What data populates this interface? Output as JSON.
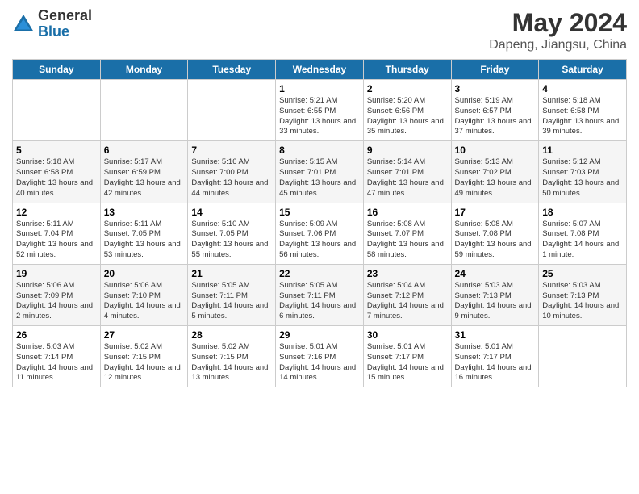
{
  "logo": {
    "general": "General",
    "blue": "Blue"
  },
  "title": {
    "month_year": "May 2024",
    "location": "Dapeng, Jiangsu, China"
  },
  "weekdays": [
    "Sunday",
    "Monday",
    "Tuesday",
    "Wednesday",
    "Thursday",
    "Friday",
    "Saturday"
  ],
  "weeks": [
    [
      {
        "day": "",
        "sunrise": "",
        "sunset": "",
        "daylight": ""
      },
      {
        "day": "",
        "sunrise": "",
        "sunset": "",
        "daylight": ""
      },
      {
        "day": "",
        "sunrise": "",
        "sunset": "",
        "daylight": ""
      },
      {
        "day": "1",
        "sunrise": "Sunrise: 5:21 AM",
        "sunset": "Sunset: 6:55 PM",
        "daylight": "Daylight: 13 hours and 33 minutes."
      },
      {
        "day": "2",
        "sunrise": "Sunrise: 5:20 AM",
        "sunset": "Sunset: 6:56 PM",
        "daylight": "Daylight: 13 hours and 35 minutes."
      },
      {
        "day": "3",
        "sunrise": "Sunrise: 5:19 AM",
        "sunset": "Sunset: 6:57 PM",
        "daylight": "Daylight: 13 hours and 37 minutes."
      },
      {
        "day": "4",
        "sunrise": "Sunrise: 5:18 AM",
        "sunset": "Sunset: 6:58 PM",
        "daylight": "Daylight: 13 hours and 39 minutes."
      }
    ],
    [
      {
        "day": "5",
        "sunrise": "Sunrise: 5:18 AM",
        "sunset": "Sunset: 6:58 PM",
        "daylight": "Daylight: 13 hours and 40 minutes."
      },
      {
        "day": "6",
        "sunrise": "Sunrise: 5:17 AM",
        "sunset": "Sunset: 6:59 PM",
        "daylight": "Daylight: 13 hours and 42 minutes."
      },
      {
        "day": "7",
        "sunrise": "Sunrise: 5:16 AM",
        "sunset": "Sunset: 7:00 PM",
        "daylight": "Daylight: 13 hours and 44 minutes."
      },
      {
        "day": "8",
        "sunrise": "Sunrise: 5:15 AM",
        "sunset": "Sunset: 7:01 PM",
        "daylight": "Daylight: 13 hours and 45 minutes."
      },
      {
        "day": "9",
        "sunrise": "Sunrise: 5:14 AM",
        "sunset": "Sunset: 7:01 PM",
        "daylight": "Daylight: 13 hours and 47 minutes."
      },
      {
        "day": "10",
        "sunrise": "Sunrise: 5:13 AM",
        "sunset": "Sunset: 7:02 PM",
        "daylight": "Daylight: 13 hours and 49 minutes."
      },
      {
        "day": "11",
        "sunrise": "Sunrise: 5:12 AM",
        "sunset": "Sunset: 7:03 PM",
        "daylight": "Daylight: 13 hours and 50 minutes."
      }
    ],
    [
      {
        "day": "12",
        "sunrise": "Sunrise: 5:11 AM",
        "sunset": "Sunset: 7:04 PM",
        "daylight": "Daylight: 13 hours and 52 minutes."
      },
      {
        "day": "13",
        "sunrise": "Sunrise: 5:11 AM",
        "sunset": "Sunset: 7:05 PM",
        "daylight": "Daylight: 13 hours and 53 minutes."
      },
      {
        "day": "14",
        "sunrise": "Sunrise: 5:10 AM",
        "sunset": "Sunset: 7:05 PM",
        "daylight": "Daylight: 13 hours and 55 minutes."
      },
      {
        "day": "15",
        "sunrise": "Sunrise: 5:09 AM",
        "sunset": "Sunset: 7:06 PM",
        "daylight": "Daylight: 13 hours and 56 minutes."
      },
      {
        "day": "16",
        "sunrise": "Sunrise: 5:08 AM",
        "sunset": "Sunset: 7:07 PM",
        "daylight": "Daylight: 13 hours and 58 minutes."
      },
      {
        "day": "17",
        "sunrise": "Sunrise: 5:08 AM",
        "sunset": "Sunset: 7:08 PM",
        "daylight": "Daylight: 13 hours and 59 minutes."
      },
      {
        "day": "18",
        "sunrise": "Sunrise: 5:07 AM",
        "sunset": "Sunset: 7:08 PM",
        "daylight": "Daylight: 14 hours and 1 minute."
      }
    ],
    [
      {
        "day": "19",
        "sunrise": "Sunrise: 5:06 AM",
        "sunset": "Sunset: 7:09 PM",
        "daylight": "Daylight: 14 hours and 2 minutes."
      },
      {
        "day": "20",
        "sunrise": "Sunrise: 5:06 AM",
        "sunset": "Sunset: 7:10 PM",
        "daylight": "Daylight: 14 hours and 4 minutes."
      },
      {
        "day": "21",
        "sunrise": "Sunrise: 5:05 AM",
        "sunset": "Sunset: 7:11 PM",
        "daylight": "Daylight: 14 hours and 5 minutes."
      },
      {
        "day": "22",
        "sunrise": "Sunrise: 5:05 AM",
        "sunset": "Sunset: 7:11 PM",
        "daylight": "Daylight: 14 hours and 6 minutes."
      },
      {
        "day": "23",
        "sunrise": "Sunrise: 5:04 AM",
        "sunset": "Sunset: 7:12 PM",
        "daylight": "Daylight: 14 hours and 7 minutes."
      },
      {
        "day": "24",
        "sunrise": "Sunrise: 5:03 AM",
        "sunset": "Sunset: 7:13 PM",
        "daylight": "Daylight: 14 hours and 9 minutes."
      },
      {
        "day": "25",
        "sunrise": "Sunrise: 5:03 AM",
        "sunset": "Sunset: 7:13 PM",
        "daylight": "Daylight: 14 hours and 10 minutes."
      }
    ],
    [
      {
        "day": "26",
        "sunrise": "Sunrise: 5:03 AM",
        "sunset": "Sunset: 7:14 PM",
        "daylight": "Daylight: 14 hours and 11 minutes."
      },
      {
        "day": "27",
        "sunrise": "Sunrise: 5:02 AM",
        "sunset": "Sunset: 7:15 PM",
        "daylight": "Daylight: 14 hours and 12 minutes."
      },
      {
        "day": "28",
        "sunrise": "Sunrise: 5:02 AM",
        "sunset": "Sunset: 7:15 PM",
        "daylight": "Daylight: 14 hours and 13 minutes."
      },
      {
        "day": "29",
        "sunrise": "Sunrise: 5:01 AM",
        "sunset": "Sunset: 7:16 PM",
        "daylight": "Daylight: 14 hours and 14 minutes."
      },
      {
        "day": "30",
        "sunrise": "Sunrise: 5:01 AM",
        "sunset": "Sunset: 7:17 PM",
        "daylight": "Daylight: 14 hours and 15 minutes."
      },
      {
        "day": "31",
        "sunrise": "Sunrise: 5:01 AM",
        "sunset": "Sunset: 7:17 PM",
        "daylight": "Daylight: 14 hours and 16 minutes."
      },
      {
        "day": "",
        "sunrise": "",
        "sunset": "",
        "daylight": ""
      }
    ]
  ]
}
